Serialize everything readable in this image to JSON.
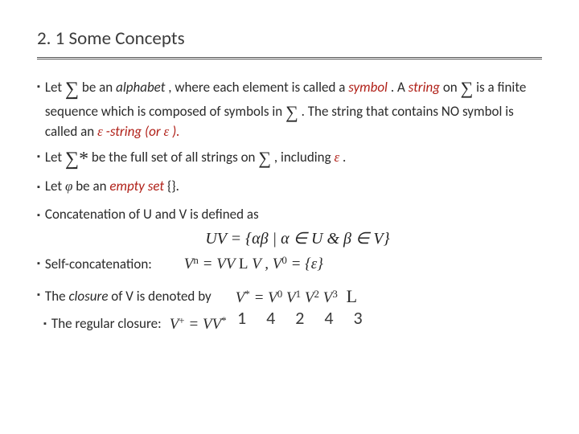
{
  "title": "2. 1 Some Concepts",
  "bullets": {
    "b1": {
      "let": "Let ",
      "sigma": "∑",
      "tx1": " be an ",
      "alphabet": "alphabet",
      "tx2": " , where each element is called a ",
      "symbol": "symbol",
      "tx3": ". A ",
      "string": "string",
      "tx4": " on ",
      "tx5": " is a finite sequence which is composed of symbols in ",
      "tx6": " . The string that contains NO symbol is called an ",
      "eps": "ε",
      "epsstr": "-string (or ",
      "eps2": "ε",
      "close": ")."
    },
    "b2": {
      "let": "Let ",
      "star": "∑*",
      "tx1": " be the full set of all strings on ",
      "sigma": "∑",
      "tx2": " , including ",
      "eps": "ε",
      "dot": " ."
    },
    "b3": {
      "let": "Let ",
      "phi": "φ",
      "tx": " be an ",
      "empty": "empty set",
      "braces": " {}."
    },
    "b4": {
      "tx": "Concatenation of U and V is defined as"
    },
    "f1": "UV = {αβ | α ∈ U  &  β ∈ V}",
    "b5": {
      "tx": "Self-concatenation:"
    },
    "f2a": "V",
    "f2b": "n",
    "f2c": " = VV",
    "f2d": "L",
    "f2e": "V",
    "f2f": ",    V",
    "f2g": "0",
    "f2h": " = {ε}",
    "overlay": "1 4 2 4 3",
    "b6": {
      "tx": "The ",
      "closure": "closure",
      "tx2": " of V is denoted by"
    },
    "f3a": "V",
    "f3b": "*",
    "f3c": " = V",
    "f3d": "0",
    "f3e": " V",
    "f3f": "1",
    "f3g": " V",
    "f3h": "2",
    "f3i": " V",
    "f3j": "3",
    "f3k": "L",
    "b7": {
      "tx": "The regular closure:  "
    },
    "f4a": "V",
    "f4b": "+",
    "f4c": " = VV",
    "f4d": "*"
  }
}
